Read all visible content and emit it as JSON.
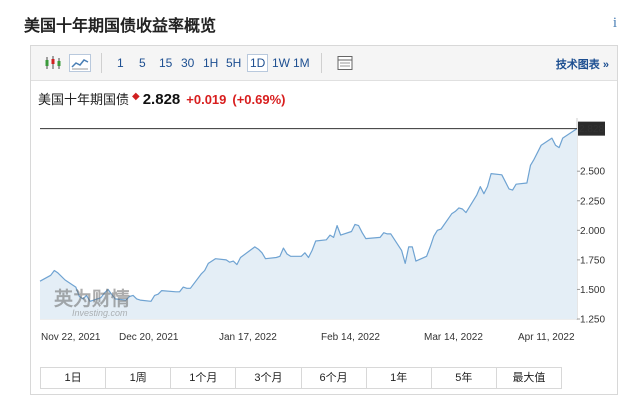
{
  "page": {
    "title": "美国十年期国债收益率概览",
    "info_icon": "i"
  },
  "toolbar": {
    "timeframes": [
      "1",
      "5",
      "15",
      "30",
      "1H",
      "5H",
      "1D",
      "1W",
      "1M"
    ],
    "active_timeframe": "1D",
    "tech_chart_label": "技术图表 »"
  },
  "quote": {
    "name": "美国十年期国债",
    "price": "2.828",
    "change": "+0.019",
    "change_pct": "(+0.69%)"
  },
  "watermark": {
    "cn": "英为财情",
    "en": "Investing.com"
  },
  "ranges": [
    "1日",
    "1周",
    "1个月",
    "3个月",
    "6个月",
    "1年",
    "5年",
    "最大值"
  ],
  "colors": {
    "line": "#6fa3d2",
    "area": "#e4eef6",
    "up": "#d81e1e",
    "link": "#1d4f91"
  },
  "chart_data": {
    "type": "area",
    "title": "",
    "xlabel": "",
    "ylabel": "",
    "ylim": [
      1.25,
      2.95
    ],
    "yticks": [
      "2.500",
      "2.250",
      "2.000",
      "1.750",
      "1.500",
      "1.250"
    ],
    "last_value_label": "2.828",
    "x_tick_labels": [
      "Nov 22, 2021",
      "Dec 20, 2021",
      "Jan 17, 2022",
      "Feb 14, 2022",
      "Mar 14, 2022",
      "Apr 11, 2022"
    ],
    "x": [
      "2021-11-19",
      "2021-11-22",
      "2021-11-23",
      "2021-11-24",
      "2021-11-26",
      "2021-11-29",
      "2021-11-30",
      "2021-12-01",
      "2021-12-02",
      "2021-12-03",
      "2021-12-06",
      "2021-12-07",
      "2021-12-08",
      "2021-12-09",
      "2021-12-10",
      "2021-12-13",
      "2021-12-14",
      "2021-12-15",
      "2021-12-16",
      "2021-12-17",
      "2021-12-20",
      "2021-12-21",
      "2021-12-22",
      "2021-12-23",
      "2021-12-27",
      "2021-12-28",
      "2021-12-29",
      "2021-12-30",
      "2021-12-31",
      "2022-01-03",
      "2022-01-04",
      "2022-01-05",
      "2022-01-06",
      "2022-01-07",
      "2022-01-10",
      "2022-01-11",
      "2022-01-12",
      "2022-01-13",
      "2022-01-14",
      "2022-01-18",
      "2022-01-19",
      "2022-01-20",
      "2022-01-21",
      "2022-01-24",
      "2022-01-25",
      "2022-01-26",
      "2022-01-27",
      "2022-01-28",
      "2022-01-31",
      "2022-02-01",
      "2022-02-02",
      "2022-02-03",
      "2022-02-04",
      "2022-02-07",
      "2022-02-08",
      "2022-02-09",
      "2022-02-10",
      "2022-02-11",
      "2022-02-14",
      "2022-02-15",
      "2022-02-16",
      "2022-02-17",
      "2022-02-18",
      "2022-02-22",
      "2022-02-23",
      "2022-02-24",
      "2022-02-25",
      "2022-02-28",
      "2022-03-01",
      "2022-03-02",
      "2022-03-03",
      "2022-03-04",
      "2022-03-07",
      "2022-03-08",
      "2022-03-09",
      "2022-03-10",
      "2022-03-11",
      "2022-03-14",
      "2022-03-15",
      "2022-03-16",
      "2022-03-17",
      "2022-03-18",
      "2022-03-21",
      "2022-03-22",
      "2022-03-23",
      "2022-03-24",
      "2022-03-25",
      "2022-03-28",
      "2022-03-29",
      "2022-03-30",
      "2022-03-31",
      "2022-04-01",
      "2022-04-04",
      "2022-04-05",
      "2022-04-06",
      "2022-04-07",
      "2022-04-08",
      "2022-04-11",
      "2022-04-12",
      "2022-04-13",
      "2022-04-14",
      "2022-04-18"
    ],
    "series": [
      {
        "values": [
          1.57,
          1.62,
          1.66,
          1.64,
          1.58,
          1.52,
          1.44,
          1.42,
          1.45,
          1.4,
          1.43,
          1.47,
          1.5,
          1.46,
          1.42,
          1.41,
          1.44,
          1.45,
          1.42,
          1.41,
          1.4,
          1.45,
          1.46,
          1.49,
          1.48,
          1.48,
          1.52,
          1.51,
          1.51,
          1.63,
          1.66,
          1.72,
          1.74,
          1.76,
          1.75,
          1.73,
          1.74,
          1.71,
          1.77,
          1.86,
          1.84,
          1.81,
          1.76,
          1.77,
          1.78,
          1.85,
          1.8,
          1.78,
          1.78,
          1.81,
          1.77,
          1.83,
          1.91,
          1.92,
          1.96,
          1.94,
          2.04,
          1.96,
          1.99,
          2.05,
          2.04,
          1.98,
          1.93,
          1.94,
          1.98,
          1.97,
          1.97,
          1.83,
          1.72,
          1.86,
          1.86,
          1.74,
          1.78,
          1.86,
          1.95,
          2.0,
          2.01,
          2.14,
          2.16,
          2.19,
          2.18,
          2.15,
          2.3,
          2.37,
          2.31,
          2.37,
          2.48,
          2.47,
          2.41,
          2.35,
          2.34,
          2.39,
          2.4,
          2.55,
          2.6,
          2.66,
          2.72,
          2.78,
          2.72,
          2.7,
          2.78,
          2.86
        ]
      }
    ],
    "grid": false,
    "legend": "none"
  }
}
